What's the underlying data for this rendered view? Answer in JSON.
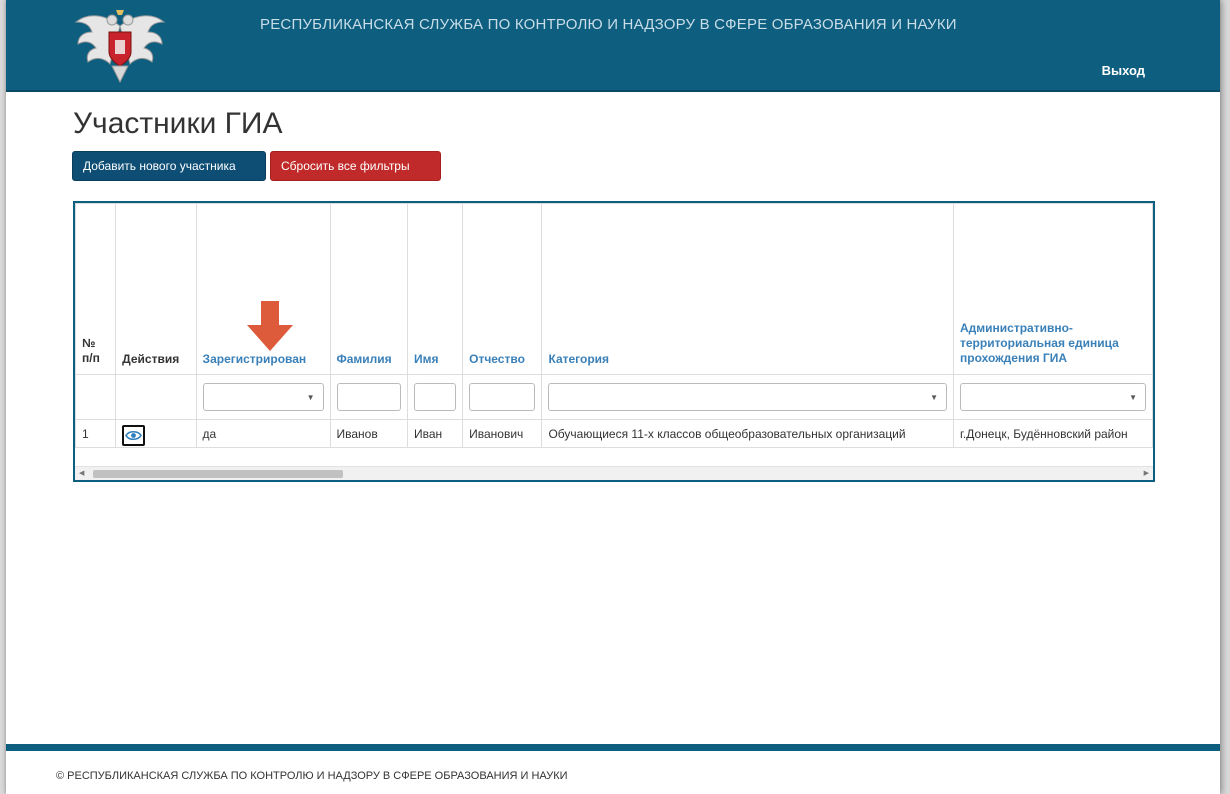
{
  "header": {
    "org_title": "РЕСПУБЛИКАНСКАЯ СЛУЖБА ПО КОНТРОЛЮ И НАДЗОРУ В СФЕРЕ ОБРАЗОВАНИЯ И НАУКИ",
    "logout_label": "Выход",
    "emblem_icon": "coat-of-arms-icon"
  },
  "page": {
    "title": "Участники ГИА"
  },
  "toolbar": {
    "add_label": "Добавить нового участника",
    "reset_label": "Сбросить все фильтры"
  },
  "grid": {
    "columns": [
      {
        "label": "№ п/п"
      },
      {
        "label": "Действия"
      },
      {
        "label": "Зарегистрирован"
      },
      {
        "label": "Фамилия"
      },
      {
        "label": "Имя"
      },
      {
        "label": "Отчество"
      },
      {
        "label": "Категория"
      },
      {
        "label": "Административно-территориальная единица прохождения ГИА"
      }
    ],
    "rows": [
      {
        "num": "1",
        "registered": "да",
        "last_name": "Иванов",
        "first_name": "Иван",
        "patronymic": "Иванович",
        "category": "Обучающиеся 11-х классов общеобразовательных организаций",
        "unit": "г.Донецк, Будённовский район"
      }
    ],
    "view_icon": "eye-icon",
    "sort_indicator_icon": "arrow-down-icon"
  },
  "colors": {
    "header_bg": "#0e5e80",
    "primary_button": "#0e4e75",
    "danger_button": "#c12a2a",
    "link_header": "#3a80b8",
    "arrow": "#dd5a3a"
  },
  "footer": {
    "copyright": "© РЕСПУБЛИКАНСКАЯ СЛУЖБА ПО КОНТРОЛЮ И НАДЗОРУ В СФЕРЕ ОБРАЗОВАНИЯ И НАУКИ"
  }
}
